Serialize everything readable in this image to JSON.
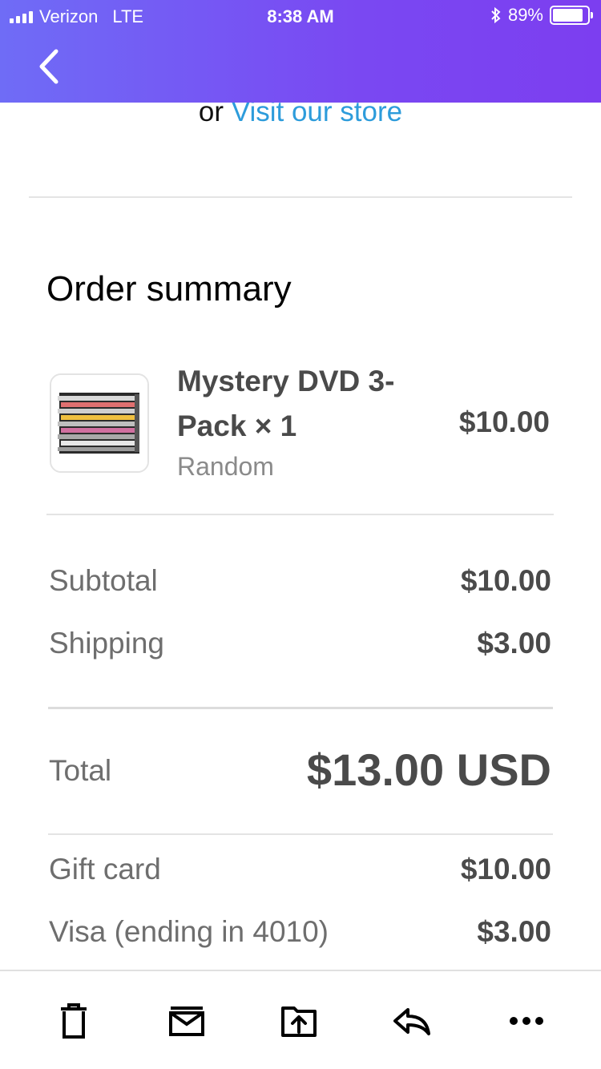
{
  "status_bar": {
    "carrier": "Verizon",
    "network": "LTE",
    "time": "8:38 AM",
    "battery_percent": "89%",
    "battery_level": 0.89
  },
  "nav": {
    "back_icon": "chevron-left-icon"
  },
  "store_link": {
    "prefix": "or",
    "link_text": "Visit our store"
  },
  "order_summary": {
    "title": "Order summary",
    "item": {
      "name": "Mystery DVD 3-Pack × 1",
      "variant": "Random",
      "price": "$10.00"
    },
    "subtotal_label": "Subtotal",
    "subtotal_value": "$10.00",
    "shipping_label": "Shipping",
    "shipping_value": "$3.00",
    "total_label": "Total",
    "total_value": "$13.00 USD",
    "payments": [
      {
        "label": "Gift card",
        "value": "$10.00"
      },
      {
        "label": "Visa (ending in 4010)",
        "value": "$3.00"
      }
    ]
  },
  "toolbar": {
    "icons": [
      "trash-icon",
      "archive-icon",
      "move-folder-icon",
      "reply-icon",
      "more-icon"
    ]
  },
  "colors": {
    "header_gradient_start": "#6f6cf6",
    "header_gradient_end": "#7c3ef0",
    "link": "#2d9cdb",
    "value_text": "#4a4a4a",
    "label_text": "#6e6e6e"
  }
}
